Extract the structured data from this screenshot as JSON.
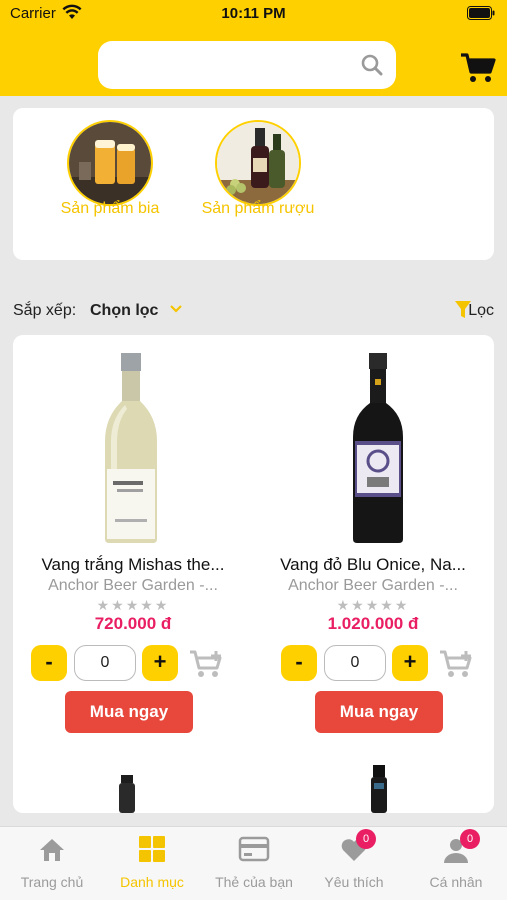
{
  "status_bar": {
    "carrier": "Carrier",
    "time": "10:11 PM"
  },
  "search": {
    "placeholder": ""
  },
  "categories": [
    {
      "label": "Sản phẩm bia"
    },
    {
      "label": "Sản phẩm rượu"
    }
  ],
  "sort": {
    "label": "Sắp xếp:",
    "value": "Chọn lọc",
    "filter_label": "Lọc"
  },
  "products": [
    {
      "name": "Vang trắng Mishas the...",
      "shop": "Anchor Beer Garden -...",
      "price": "720.000 đ",
      "quantity": "0",
      "buy_label": "Mua ngay",
      "rating": 0
    },
    {
      "name": "Vang đỏ Blu Onice, Na...",
      "shop": "Anchor Beer Garden -...",
      "price": "1.020.000 đ",
      "quantity": "0",
      "buy_label": "Mua ngay",
      "rating": 0
    }
  ],
  "qty_buttons": {
    "minus": "-",
    "plus": "+"
  },
  "stars": "★★★★★",
  "tabbar": [
    {
      "label": "Trang chủ",
      "icon": "home-icon"
    },
    {
      "label": "Danh mục",
      "icon": "grid-icon",
      "active": true
    },
    {
      "label": "Thẻ của bạn",
      "icon": "card-icon"
    },
    {
      "label": "Yêu thích",
      "icon": "heart-icon",
      "badge": "0"
    },
    {
      "label": "Cá nhân",
      "icon": "user-icon",
      "badge": "0"
    }
  ],
  "colors": {
    "brand": "#ffd000",
    "price": "#e91e63",
    "buy": "#e8473b",
    "active_tab": "#f5c400"
  }
}
